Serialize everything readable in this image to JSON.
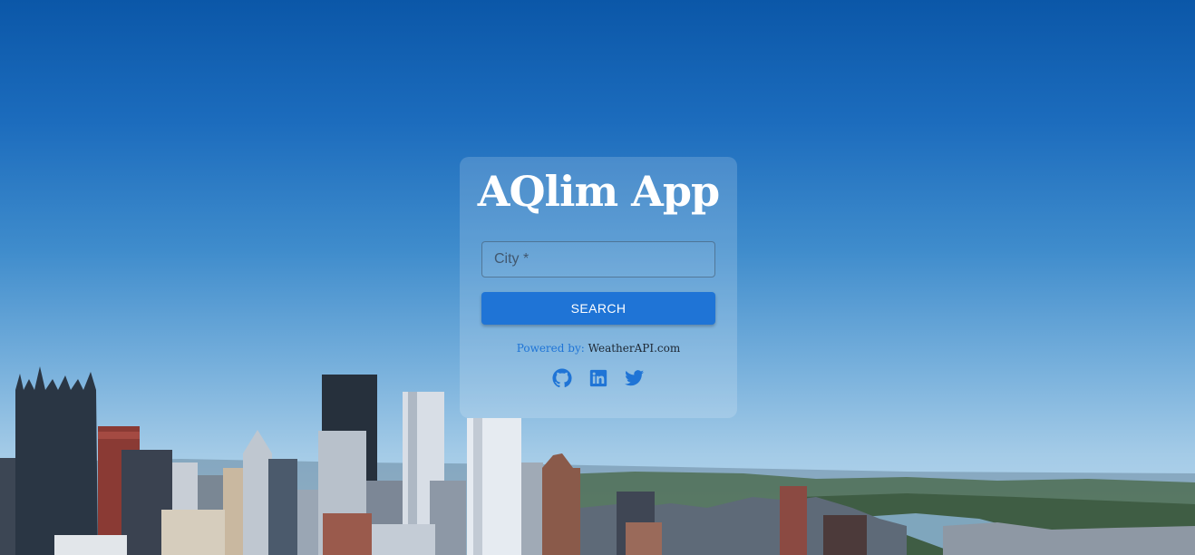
{
  "app": {
    "title": "AQlim App"
  },
  "search": {
    "placeholder": "City *",
    "value": "",
    "button_label": "SEARCH"
  },
  "footer": {
    "powered_label": "Powered by:",
    "powered_link": "WeatherAPI.com"
  },
  "socials": [
    {
      "name": "github-icon"
    },
    {
      "name": "linkedin-icon"
    },
    {
      "name": "twitter-icon"
    }
  ],
  "colors": {
    "accent": "#1f74d6",
    "title": "#ffffff",
    "sky_top": "#0b57a8",
    "sky_bottom": "#c0dbee"
  }
}
